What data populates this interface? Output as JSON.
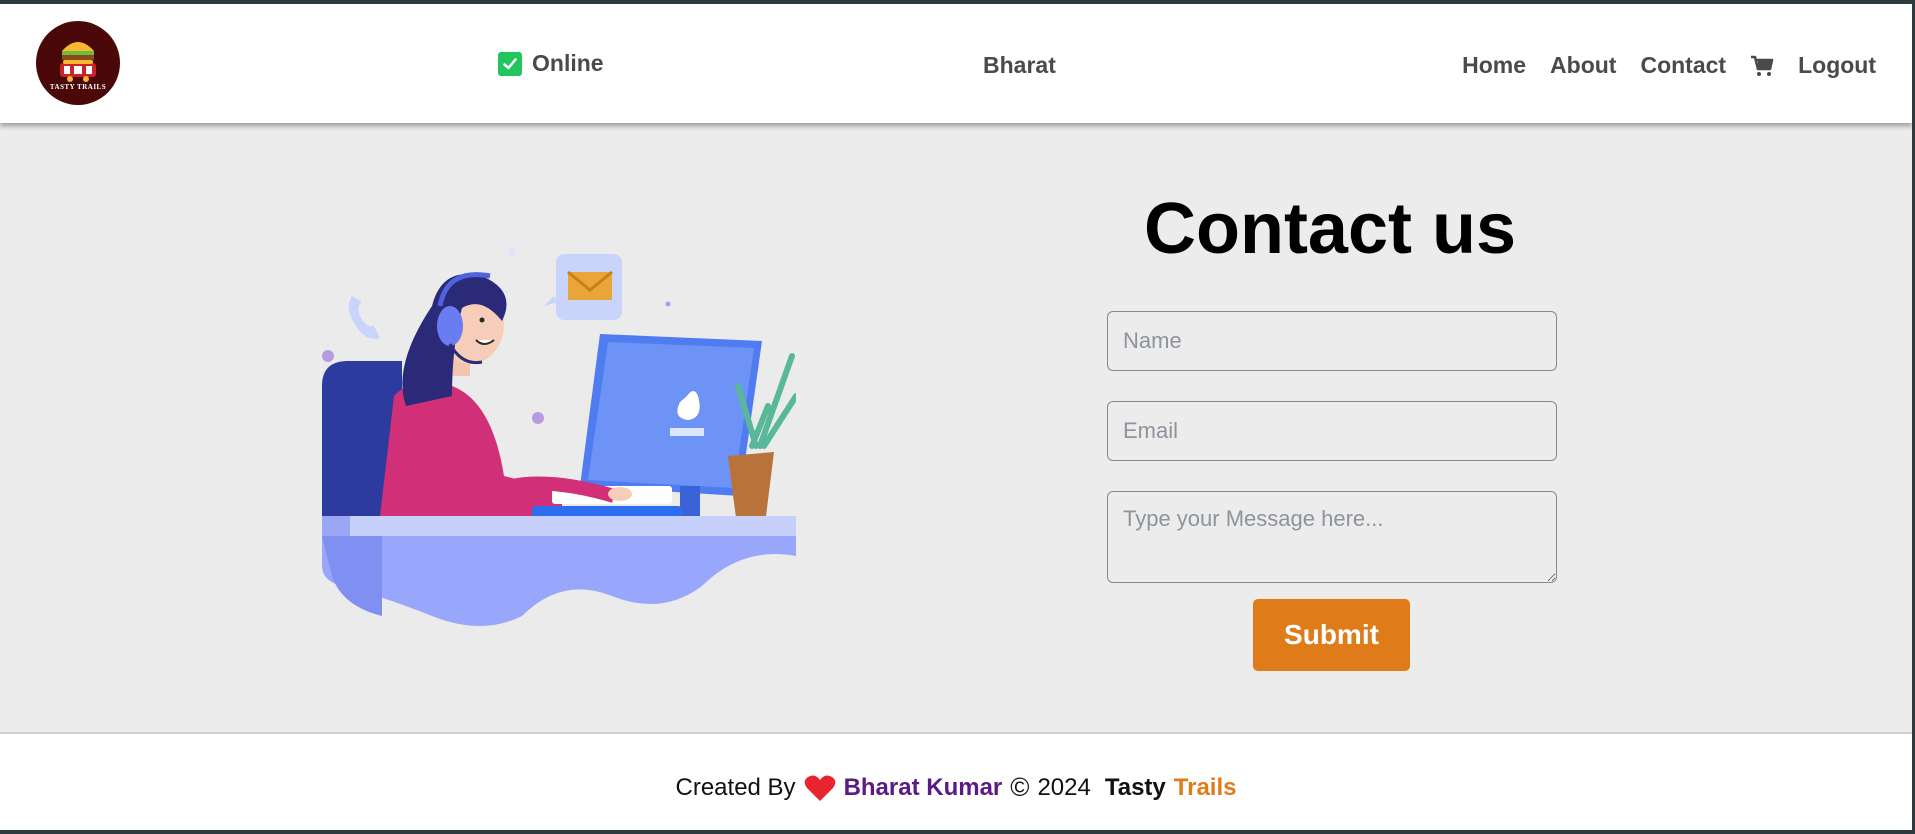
{
  "header": {
    "logo_text": "TASTY TRAILS",
    "status_label": "Online",
    "user_name": "Bharat",
    "nav": {
      "home": "Home",
      "about": "About",
      "contact": "Contact",
      "cart_icon": "cart-icon",
      "logout": "Logout"
    }
  },
  "main": {
    "title": "Contact us",
    "name_placeholder": "Name",
    "email_placeholder": "Email",
    "message_placeholder": "Type your Message here...",
    "submit_label": "Submit"
  },
  "footer": {
    "created_by": "Created By",
    "author": "Bharat Kumar",
    "copyright_symbol": "©",
    "year": "2024",
    "brand_first": "Tasty",
    "brand_second": "Trails"
  },
  "colors": {
    "accent": "#e07b1a",
    "author": "#5b1a84",
    "status_check": "#22c55e",
    "logo_bg": "#4a0808",
    "page_bg": "#ececec"
  }
}
